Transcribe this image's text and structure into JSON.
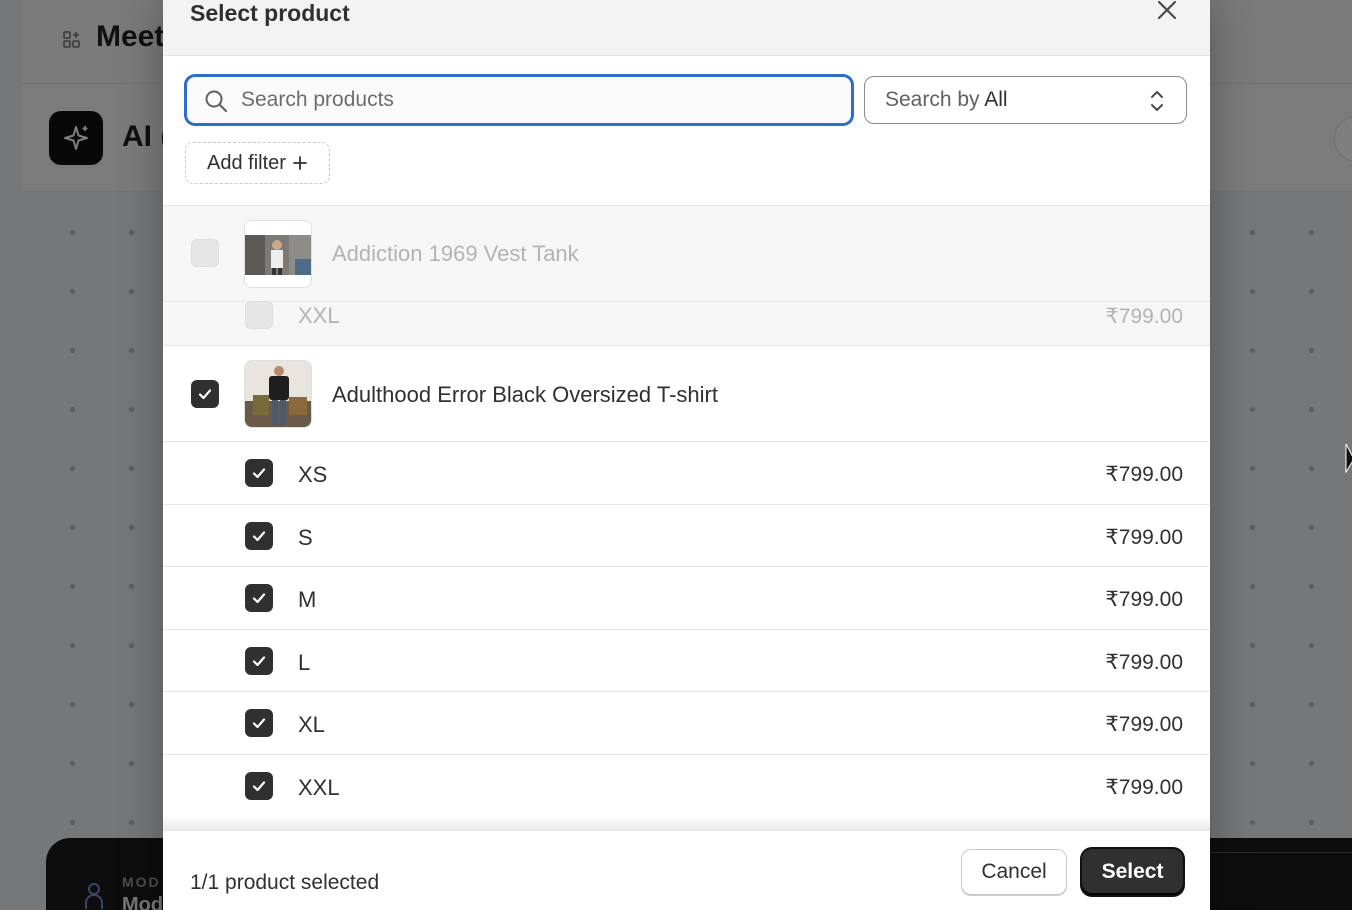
{
  "background": {
    "page_title": "Meet",
    "card_title": "AI (",
    "bottom_panel": {
      "label": "MOD",
      "value": "Mod"
    }
  },
  "modal": {
    "title": "Select product",
    "search": {
      "placeholder": "Search products",
      "value": ""
    },
    "search_by": {
      "prefix": "Search by",
      "value": "All"
    },
    "add_filter_label": "Add filter"
  },
  "products": [
    {
      "title": "Addiction 1969 Vest Tank",
      "checked": false,
      "disabled": true,
      "variants": [
        {
          "label": "XXL",
          "price": "₹799.00",
          "checked": false
        }
      ]
    },
    {
      "title": "Adulthood Error Black Oversized T-shirt",
      "checked": true,
      "disabled": false,
      "variants": [
        {
          "label": "XS",
          "price": "₹799.00",
          "checked": true
        },
        {
          "label": "S",
          "price": "₹799.00",
          "checked": true
        },
        {
          "label": "M",
          "price": "₹799.00",
          "checked": true
        },
        {
          "label": "L",
          "price": "₹799.00",
          "checked": true
        },
        {
          "label": "XL",
          "price": "₹799.00",
          "checked": true
        },
        {
          "label": "XXL",
          "price": "₹799.00",
          "checked": true
        }
      ]
    }
  ],
  "footer": {
    "status": "1/1 product selected",
    "cancel_label": "Cancel",
    "select_label": "Select"
  },
  "colors": {
    "accent": "#2c6ecb",
    "primary_button": "#303030",
    "overlay": "rgba(0,0,0,0.5)"
  }
}
